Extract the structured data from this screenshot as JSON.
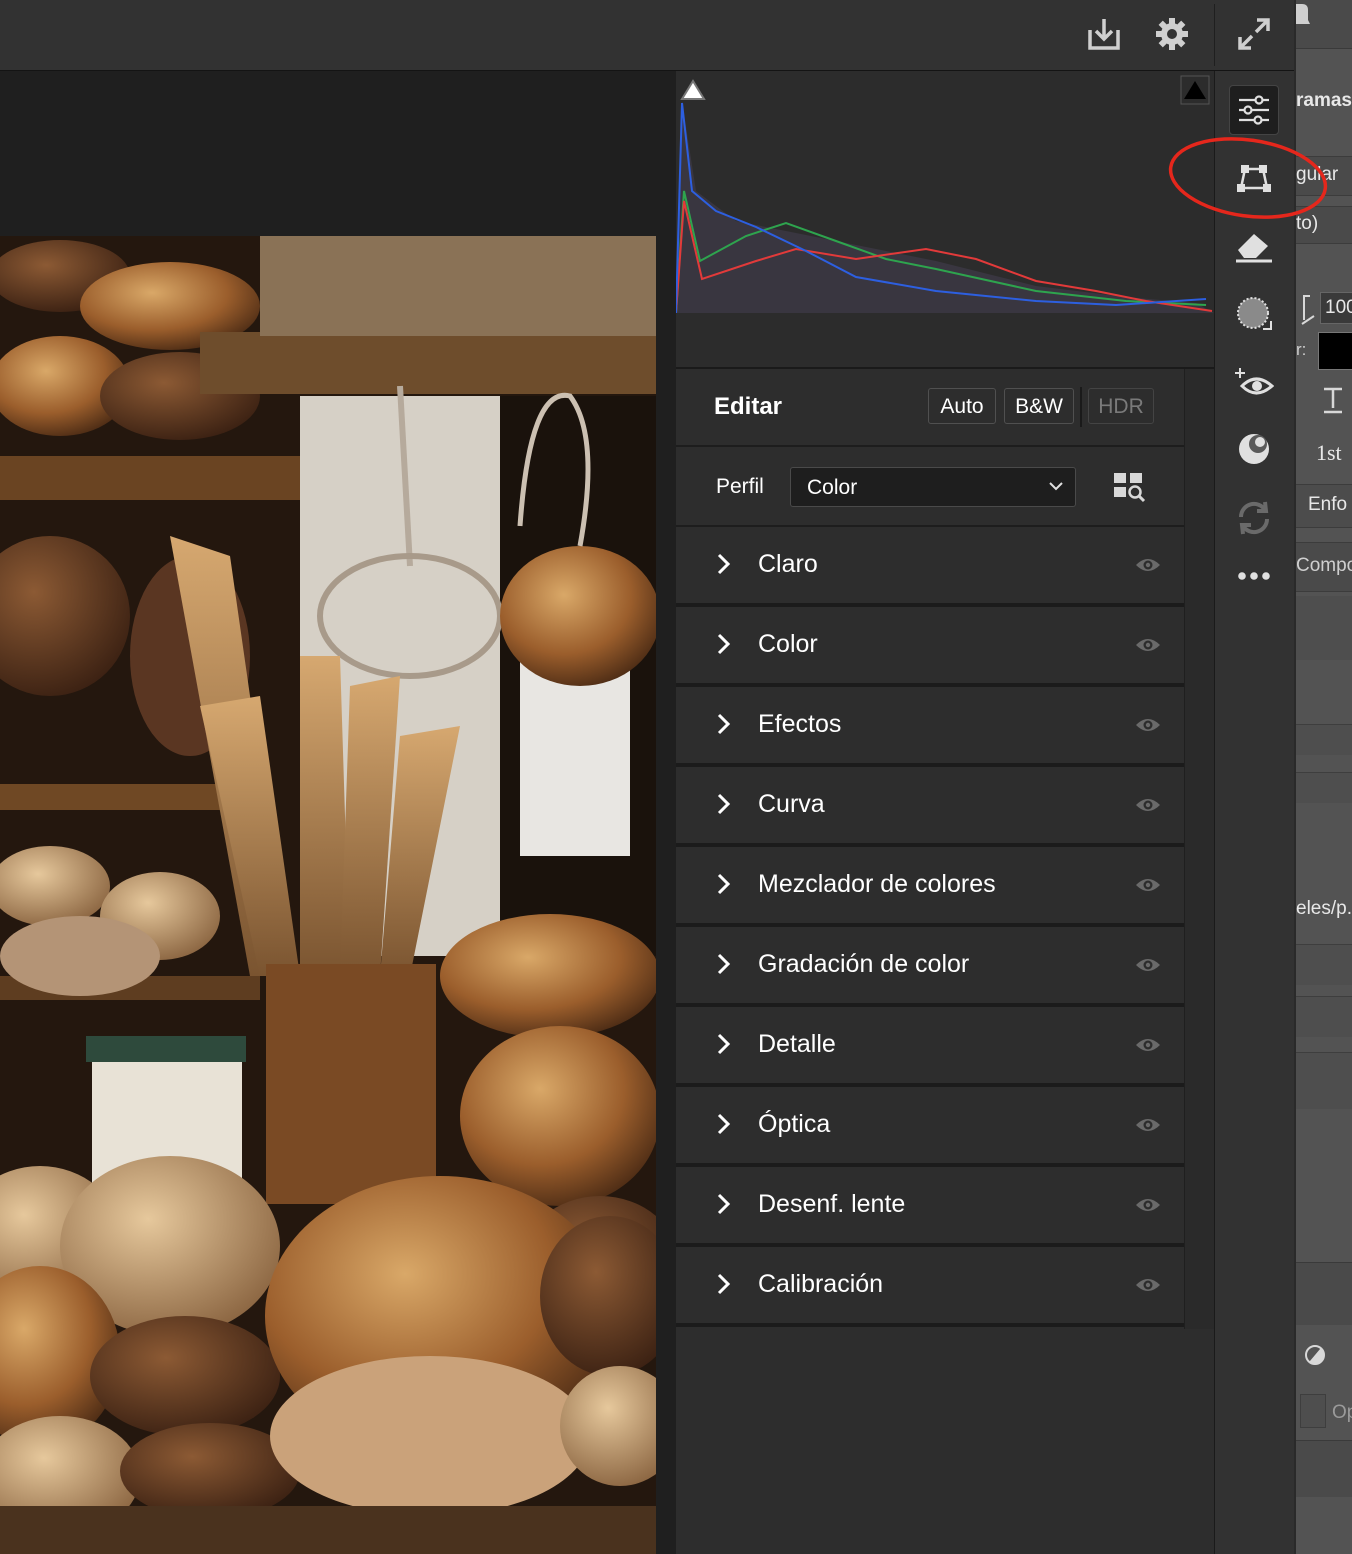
{
  "topbar": {
    "icons": [
      "export-icon",
      "settings-icon",
      "expand-icon"
    ]
  },
  "panel": {
    "title": "Editar",
    "buttons": [
      "Auto",
      "B&W",
      "HDR"
    ],
    "profile": {
      "label": "Perfil",
      "value": "Color"
    },
    "sections": [
      "Claro",
      "Color",
      "Efectos",
      "Curva",
      "Mezclador de colores",
      "Gradación de color",
      "Detalle",
      "Óptica",
      "Desenf. lente",
      "Calibración"
    ]
  },
  "tools": [
    "edit-sliders-icon",
    "transform-icon",
    "eraser-icon",
    "mask-icon",
    "red-eye-icon",
    "presets-icon",
    "sync-icon",
    "more-icon"
  ],
  "rightpane": {
    "t1": "ramas",
    "t2": "gular",
    "t3": "to)",
    "t4": "100",
    "t5": "r:",
    "t6": "Enfo",
    "t7": "Compo",
    "t8": "eles/p.",
    "t9": "Op",
    "t10": "1st"
  },
  "colors": {
    "annotation": "#e5271c",
    "panel_bg": "#2d2d2d",
    "toolbar_bg": "#323232"
  }
}
